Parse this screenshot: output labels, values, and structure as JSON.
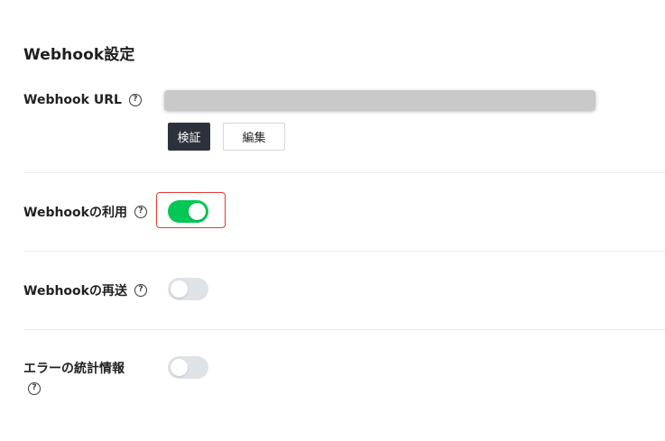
{
  "section": {
    "title": "Webhook設定"
  },
  "webhook_url": {
    "label": "Webhook URL",
    "help_icon": "?",
    "verify_button": "検証",
    "edit_button": "編集"
  },
  "use_webhook": {
    "label": "Webhookの利用",
    "help_icon": "?",
    "enabled": true
  },
  "redelivery": {
    "label": "Webhookの再送",
    "help_icon": "?",
    "enabled": false
  },
  "error_stats": {
    "label": "エラーの統計情報",
    "help_icon": "?",
    "enabled": false
  },
  "colors": {
    "toggle_on": "#06c755",
    "toggle_off": "#dfe2e6",
    "highlight": "#e53935",
    "primary_button": "#2d313c"
  }
}
